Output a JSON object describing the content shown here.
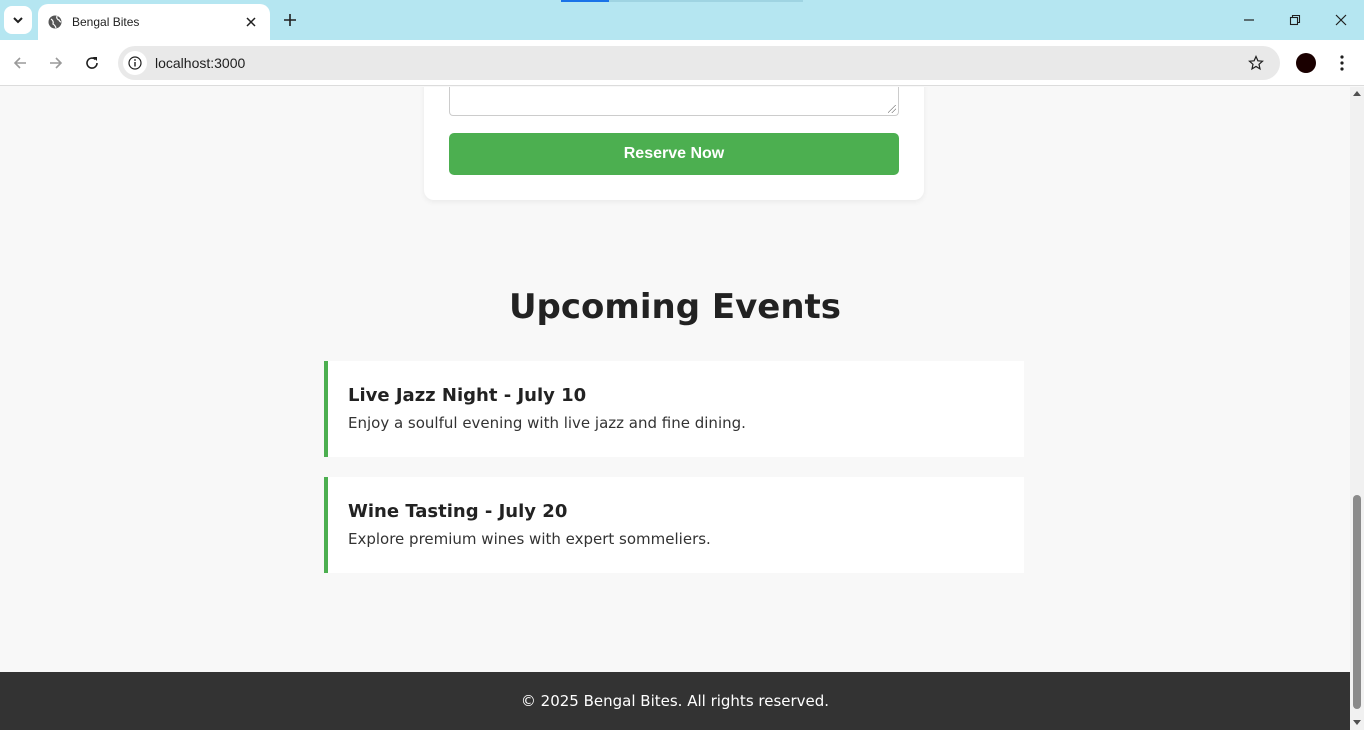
{
  "browser": {
    "tab_title": "Bengal Bites",
    "url": "localhost:3000"
  },
  "colors": {
    "accent": "#4caf50",
    "footer_bg": "#333333",
    "titlebar": "#b5e6f1"
  },
  "reservation": {
    "button_label": "Reserve Now"
  },
  "events": {
    "heading": "Upcoming Events",
    "items": [
      {
        "title": "Live Jazz Night - July 10",
        "description": "Enjoy a soulful evening with live jazz and fine dining."
      },
      {
        "title": "Wine Tasting - July 20",
        "description": "Explore premium wines with expert sommeliers."
      }
    ]
  },
  "footer": {
    "text": "© 2025 Bengal Bites. All rights reserved."
  },
  "icons": [
    "tab-list-icon",
    "globe-icon",
    "close-icon",
    "plus-icon",
    "minimize-icon",
    "restore-icon",
    "back-icon",
    "forward-icon",
    "reload-icon",
    "site-info-icon",
    "star-icon",
    "kebab-menu-icon"
  ]
}
